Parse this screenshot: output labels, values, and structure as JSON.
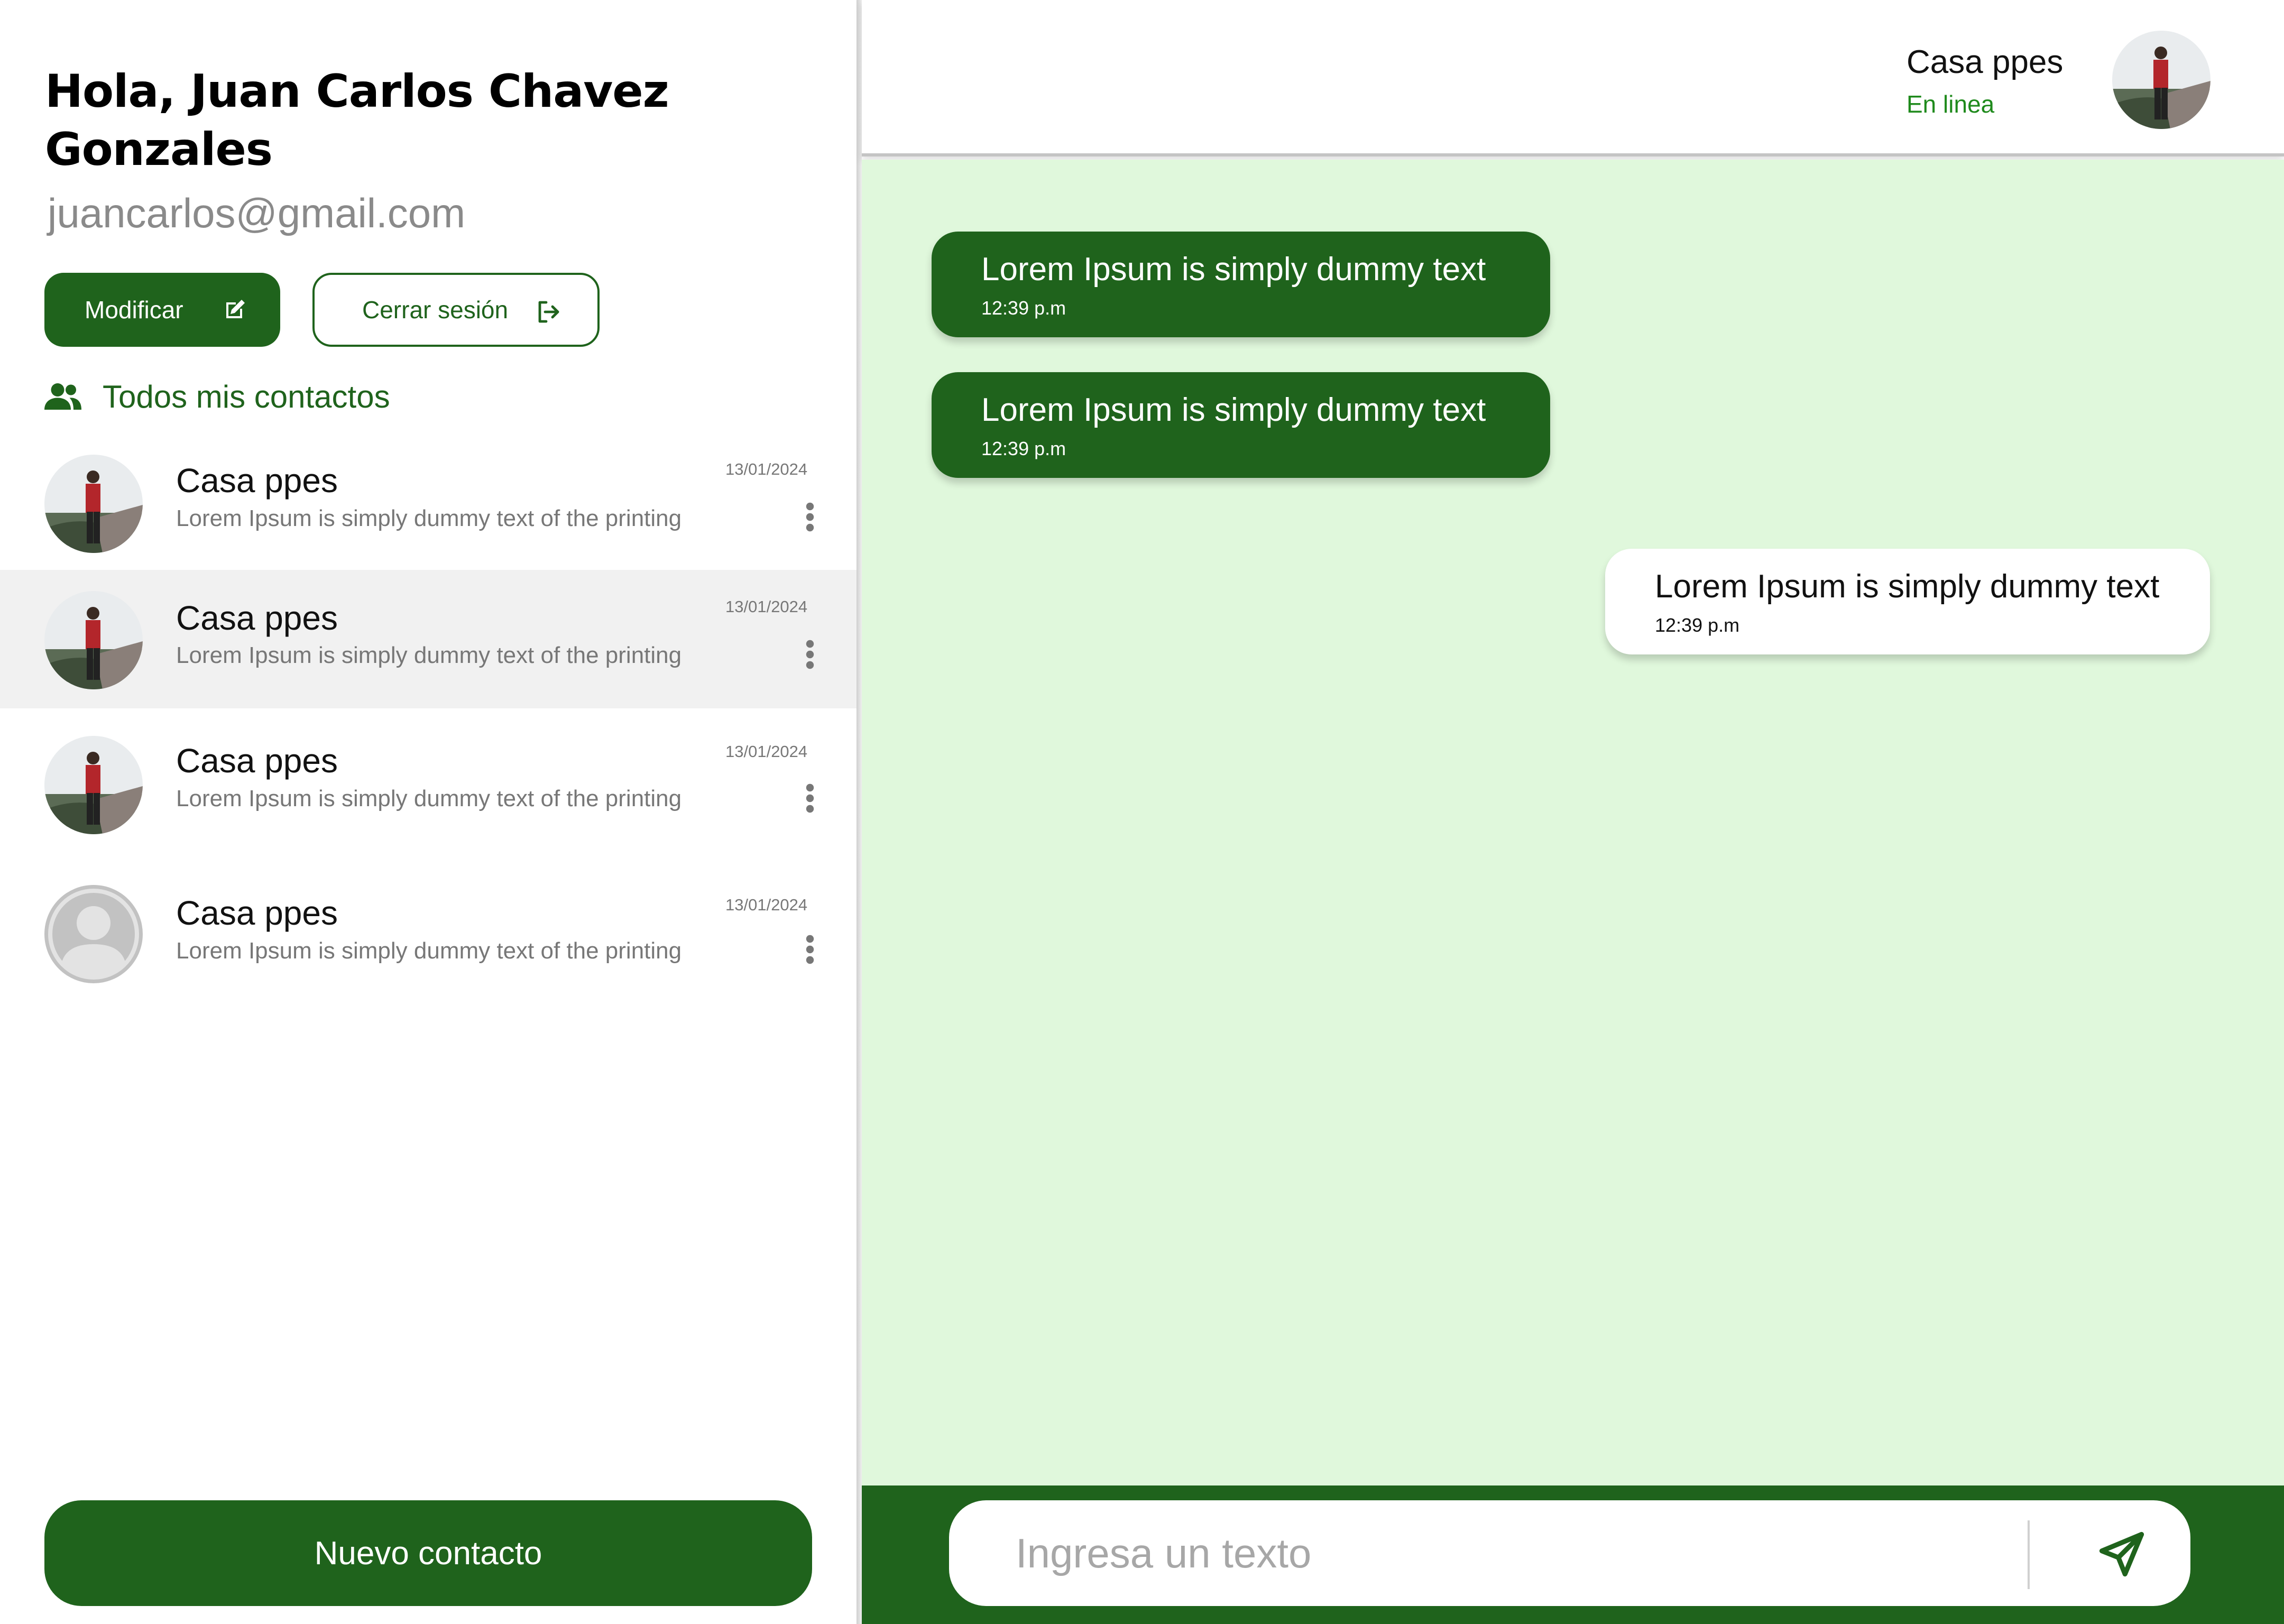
{
  "user": {
    "greeting": "Hola, Juan Carlos Chavez Gonzales",
    "email": "juancarlos@gmail.com"
  },
  "actions": {
    "modify_label": "Modificar",
    "logout_label": "Cerrar sesión",
    "new_contact_label": "Nuevo contacto"
  },
  "contacts": {
    "heading": "Todos mis contactos",
    "items": [
      {
        "name": "Casa ppes",
        "preview": "Lorem Ipsum is simply dummy text of the printing",
        "date": "13/01/2024",
        "avatar": "photo"
      },
      {
        "name": "Casa ppes",
        "preview": "Lorem Ipsum is simply dummy text of the printing",
        "date": "13/01/2024",
        "avatar": "photo",
        "selected": true
      },
      {
        "name": "Casa ppes",
        "preview": "Lorem Ipsum is simply dummy text of the printing",
        "date": "13/01/2024",
        "avatar": "photo"
      },
      {
        "name": "Casa ppes",
        "preview": "Lorem Ipsum is simply dummy text of the printing",
        "date": "13/01/2024",
        "avatar": "placeholder"
      }
    ]
  },
  "chat": {
    "contact_name": "Casa ppes",
    "status": "En linea",
    "messages": [
      {
        "text": "Lorem Ipsum is simply dummy text",
        "time": "12:39 p.m",
        "direction": "in"
      },
      {
        "text": "Lorem Ipsum is simply dummy text",
        "time": "12:39 p.m",
        "direction": "in"
      },
      {
        "text": "Lorem Ipsum is simply dummy text",
        "time": "12:39 p.m",
        "direction": "out"
      }
    ],
    "input_placeholder": "Ingresa un texto"
  },
  "colors": {
    "primary": "#1f631c",
    "online": "#1f8a1c",
    "chat_background": "#e0f8dc",
    "selected_row": "#f1f1f1"
  },
  "icons": {
    "modify": "edit-icon",
    "logout": "logout-icon",
    "contacts": "users-icon",
    "item_menu": "more-vertical-icon",
    "send": "send-icon"
  }
}
